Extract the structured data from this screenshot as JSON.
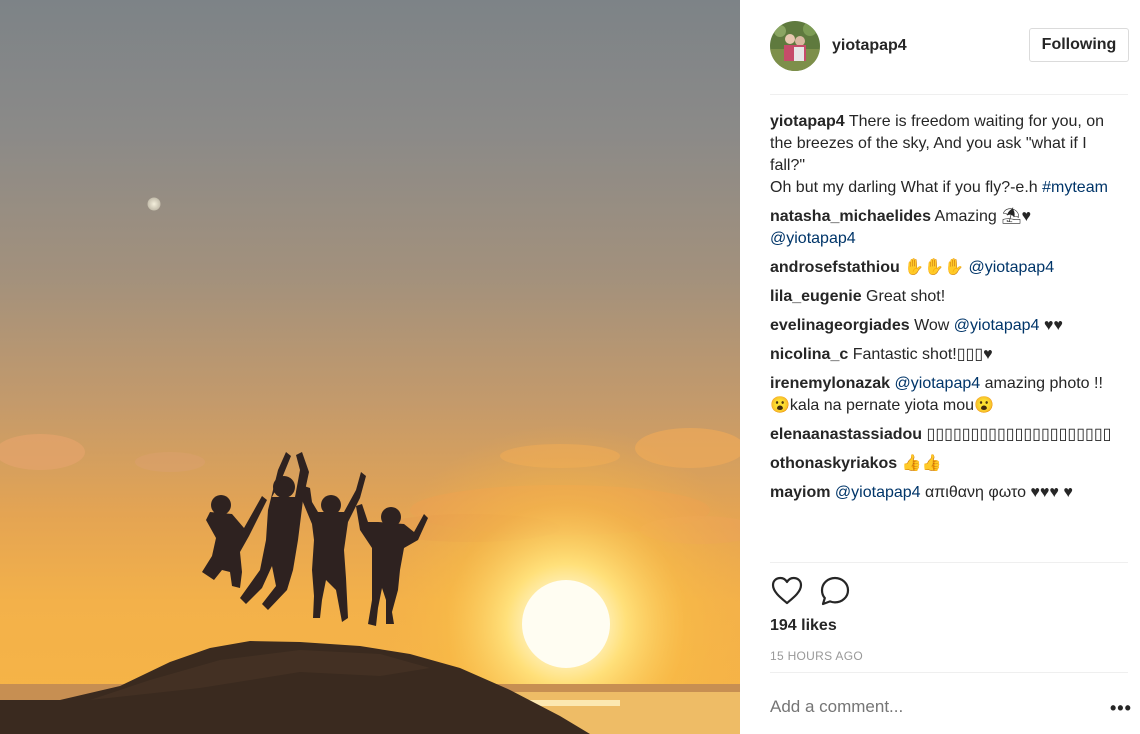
{
  "post": {
    "username": "yiotapap4",
    "follow_label": "Following"
  },
  "caption": {
    "user": "yiotapap4",
    "text": " There is freedom waiting for you, on the breezes of the sky, And you ask \"what if I fall?\"\nOh but my darling What if you fly?-e.h ",
    "tag": "#myteam"
  },
  "comments": [
    {
      "user": "natasha_michaelides",
      "pre": " Amazing ⛱♥ ",
      "mention": "@yiotapap4",
      "post": ""
    },
    {
      "user": "androsefstathiou",
      "pre": " ✋✋✋ ",
      "mention": "@yiotapap4",
      "post": ""
    },
    {
      "user": "lila_eugenie",
      "pre": " Great shot!",
      "mention": "",
      "post": ""
    },
    {
      "user": "evelinageorgiades",
      "pre": " Wow ",
      "mention": "@yiotapap4",
      "post": " ♥♥"
    },
    {
      "user": "nicolina_c",
      "pre": " Fantastic shot!▯▯▯♥",
      "mention": "",
      "post": ""
    },
    {
      "user": "irenemylonazak",
      "pre": " ",
      "mention": "@yiotapap4",
      "post": " amazing photo !!😮kala na pernate yiota mou😮"
    },
    {
      "user": "elenaanastassiadou",
      "pre": " ▯▯▯▯▯▯▯▯▯▯▯▯▯▯▯▯▯▯▯▯▯",
      "mention": "",
      "post": ""
    },
    {
      "user": "othonaskyriakos",
      "pre": " 👍👍",
      "mention": "",
      "post": ""
    },
    {
      "user": "mayiom",
      "pre": " ",
      "mention": "@yiotapap4",
      "post": " απιθανη φωτο ♥♥♥ ♥"
    }
  ],
  "actions": {
    "like_icon": "heart-outline-icon",
    "comment_icon": "speech-bubble-icon"
  },
  "likes": "194 likes",
  "timestamp": "15 HOURS AGO",
  "comment_input": {
    "placeholder": "Add a comment..."
  },
  "more_label": "•••",
  "colors": {
    "link": "#003569",
    "border": "#efefef",
    "muted": "#999999"
  }
}
